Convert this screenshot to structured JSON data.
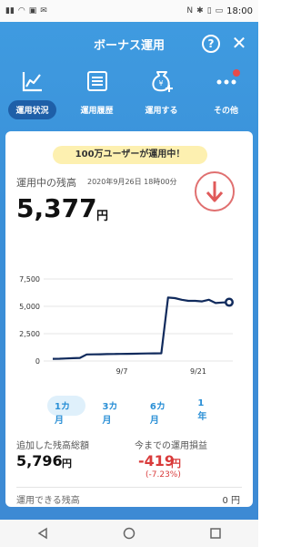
{
  "status": {
    "time": "18:00"
  },
  "header": {
    "title": "ボーナス運用"
  },
  "tabs": [
    {
      "label": "運用状況",
      "icon": "line-chart-icon"
    },
    {
      "label": "運用履歴",
      "icon": "list-icon"
    },
    {
      "label": "運用する",
      "icon": "money-bag-plus-icon"
    },
    {
      "label": "その他",
      "icon": "more-icon"
    }
  ],
  "promo": "100万ユーザーが運用中！",
  "balance": {
    "label": "運用中の残高",
    "date": "2020年9月26日 18時00分",
    "value": "5,377",
    "unit": "円"
  },
  "chart_data": {
    "type": "line",
    "series": [
      {
        "values": [
          200,
          210,
          230,
          260,
          280,
          600,
          610,
          620,
          630,
          640,
          650,
          660,
          670,
          680,
          690,
          700,
          710,
          5800,
          5750,
          5600,
          5500,
          5500,
          5450,
          5600,
          5300,
          5350,
          5377
        ]
      }
    ],
    "x_ticks": [
      "9/7",
      "9/21"
    ],
    "y_ticks": [
      "7,500",
      "5,000",
      "2,500",
      "0"
    ],
    "ylim": [
      0,
      7500
    ]
  },
  "periods": [
    "1カ月",
    "3カ月",
    "6カ月",
    "1年"
  ],
  "stats": {
    "added_label": "追加した残高総額",
    "added_value": "5,796",
    "added_unit": "円",
    "pl_label": "今までの運用損益",
    "pl_value": "-419",
    "pl_unit": "円",
    "pl_pct": "(-7.23%)"
  },
  "available": {
    "label": "運用できる残高",
    "value": "0 円"
  }
}
